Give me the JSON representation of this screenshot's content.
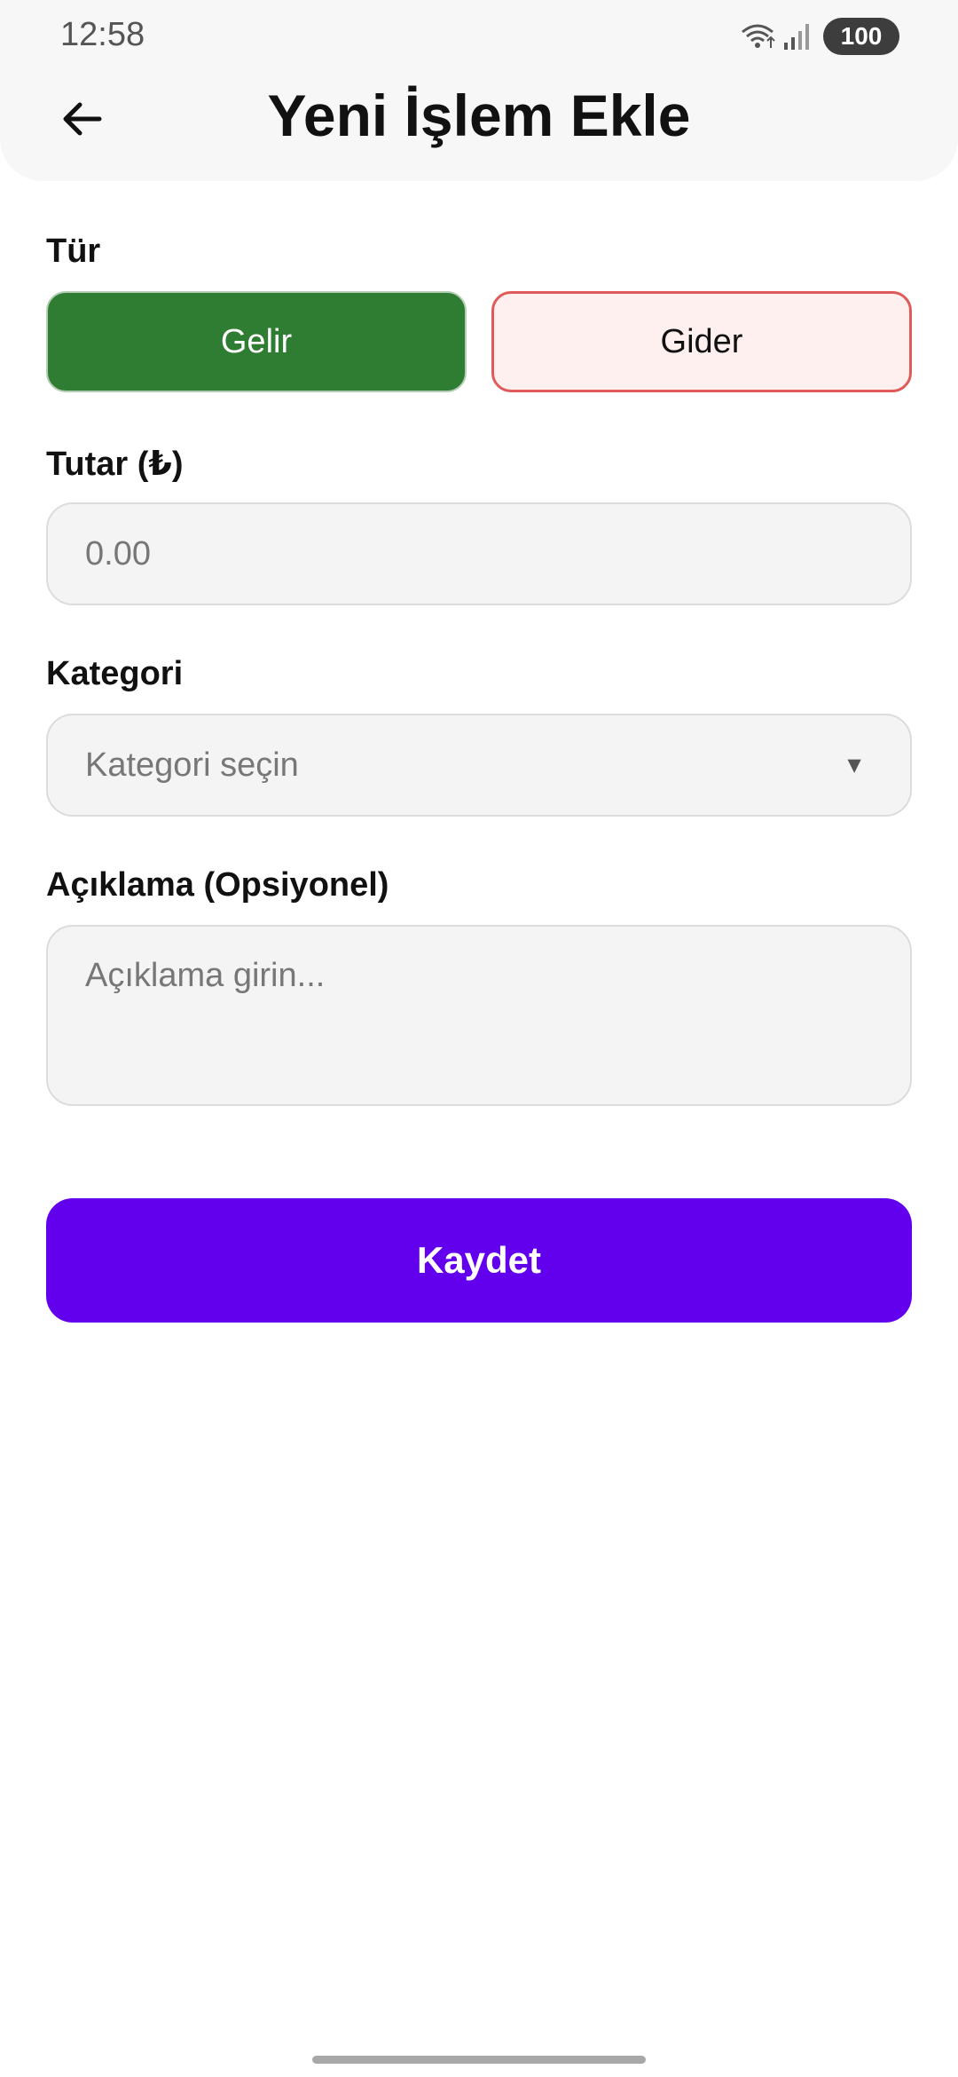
{
  "status_bar": {
    "time": "12:58",
    "battery": "100",
    "icons": [
      "wifi-icon",
      "signal-icon",
      "battery-icon"
    ]
  },
  "header": {
    "title": "Yeni İşlem Ekle",
    "back_icon": "back-arrow-icon"
  },
  "form": {
    "type": {
      "label": "Tür",
      "options": [
        "Gelir",
        "Gider"
      ],
      "selected": "Gelir"
    },
    "amount": {
      "label": "Tutar (₺)",
      "placeholder": "0.00",
      "value": ""
    },
    "category": {
      "label": "Kategori",
      "placeholder": "Kategori seçin",
      "icon": "dropdown-arrow-icon"
    },
    "description": {
      "label": "Açıklama (Opsiyonel)",
      "placeholder": "Açıklama girin..."
    },
    "save_label": "Kaydet"
  },
  "colors": {
    "income_active": "#2f7d32",
    "expense_border": "#e05a5a",
    "expense_bg": "#fff0f0",
    "primary": "#6200ee",
    "field_bg": "#f4f4f4"
  }
}
